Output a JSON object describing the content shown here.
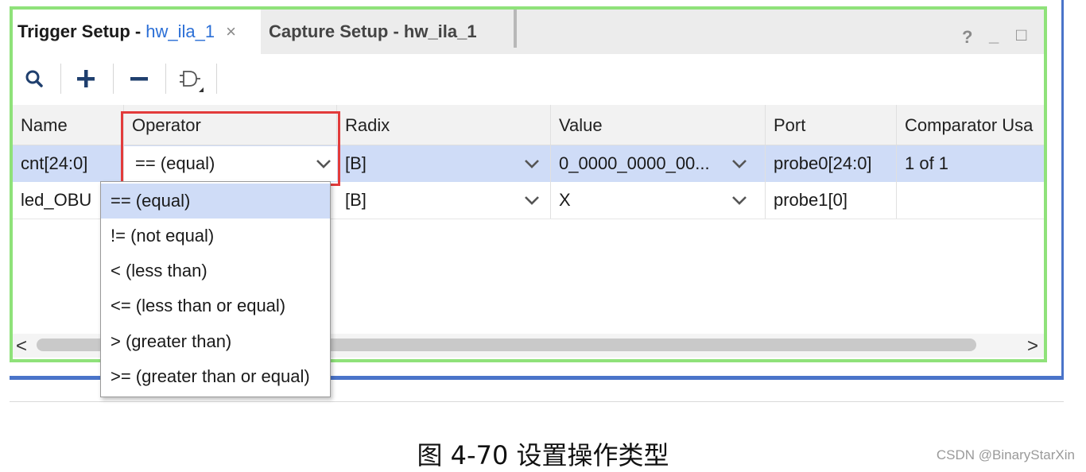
{
  "tabs": {
    "active": {
      "title": "Trigger Setup - ",
      "suffix": "hw_ila_1",
      "close": "×"
    },
    "inactive": {
      "title": "Capture Setup - hw_ila_1"
    }
  },
  "window_controls": {
    "help": "?",
    "minimize": "_",
    "maximize": "□"
  },
  "toolbar": {
    "icons": [
      "search-icon",
      "add-icon",
      "remove-icon",
      "logic-gate-icon"
    ]
  },
  "table": {
    "columns": [
      "Name",
      "Operator",
      "Radix",
      "Value",
      "Port",
      "Comparator Usa"
    ],
    "rows": [
      {
        "name": "cnt[24:0]",
        "operator": "== (equal)",
        "radix": "[B]",
        "value": "0_0000_0000_00...",
        "port": "probe0[24:0]",
        "comparator": "1 of 1"
      },
      {
        "name": "led_OBU",
        "operator": "",
        "radix": "[B]",
        "value": "X",
        "port": "probe1[0]",
        "comparator": ""
      }
    ]
  },
  "dropdown": {
    "options": [
      "== (equal)",
      "!= (not equal)",
      "< (less than)",
      "<= (less than or equal)",
      "> (greater than)",
      ">= (greater than or equal)"
    ],
    "selected_index": 0
  },
  "scrollbar": {
    "left": "<",
    "right": ">"
  },
  "caption": "图 4-70 设置操作类型",
  "watermark": "CSDN @BinaryStarXin",
  "colors": {
    "highlight": "#e23b3b",
    "frame_green": "#8fe27a",
    "frame_blue": "#4a74c9",
    "selection": "#cfdcf7",
    "link": "#2b6fd6"
  }
}
